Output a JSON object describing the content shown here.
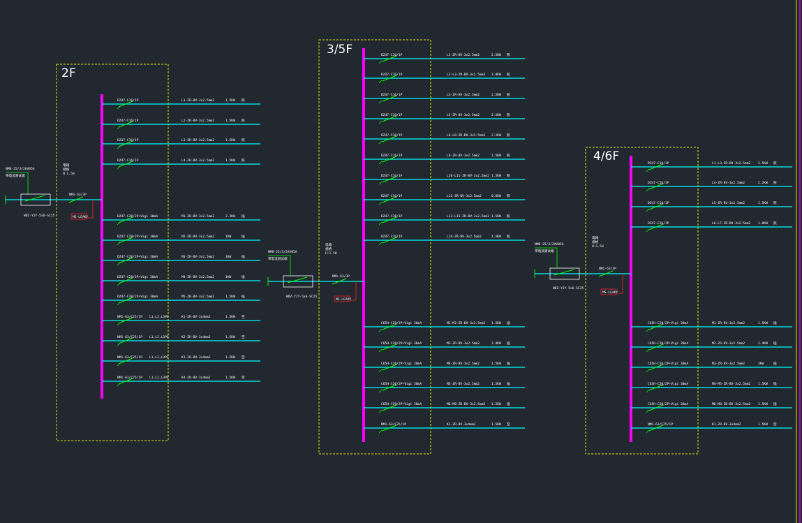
{
  "colors": {
    "background": "#212830",
    "busbar": "#ff00ff",
    "feeder_line": "#00ffff",
    "breaker": "#00ff00",
    "panel_border": "#e6e600",
    "text": "#ffffff",
    "tag": "#ff2020"
  },
  "panels": [
    {
      "title": "2F",
      "incoming": {
        "meter_label": "NM8-25/3/2AV05A",
        "meter_sub": "带电流测试端",
        "cable": "WDZ-YJY-5x6-SC25",
        "panel_info": [
          "电箱",
          "规格",
          "H:1.5H"
        ],
        "main_breaker": "NM1-63/3P",
        "tag": "MS-LEAKY"
      },
      "circuits": [
        {
          "breaker": "DZ47-C16/1P",
          "cable": "L1-ZR-BV-3x2.5mm2",
          "power": "1.5KW",
          "use": "照"
        },
        {
          "breaker": "DZ47-C16/1P",
          "cable": "L2-ZR-BV-3x2.5mm2",
          "power": "1.5KW",
          "use": "照"
        },
        {
          "breaker": "DZ47-C16/1P",
          "cable": "L3-ZR-BV-3x2.5mm2",
          "power": "1.5KW",
          "use": "照"
        },
        {
          "breaker": "DZ47-C16/1P",
          "cable": "L4-ZR-BV-3x2.5mm2",
          "power": "1.5KW",
          "use": "照"
        },
        {
          "breaker": "DZ47-C20/2P+Vigi 30mA",
          "cable": "M1-ZR-BV-3x2.5mm2",
          "power": "2.2KW",
          "use": "插"
        },
        {
          "breaker": "DZ47-C20/2P+Vigi 30mA",
          "cable": "M2-ZR-BV-3x2.5mm2",
          "power": "1KW",
          "use": "插"
        },
        {
          "breaker": "DZ47-C20/2P+Vigi 30mA",
          "cable": "M3-ZR-BV-3x2.5mm2",
          "power": "1KW",
          "use": "插"
        },
        {
          "breaker": "DZ47-C20/2P+Vigi 30mA",
          "cable": "M4-ZR-BV-3x2.5mm2",
          "power": "1KW",
          "use": "插"
        },
        {
          "breaker": "DZ47-C20/2P+Vigi 30mA",
          "cable": "M5-ZR-BV-3x2.5mm2",
          "power": "1.5KW",
          "use": "插"
        },
        {
          "breaker": "NM1-63/C25/1P",
          "extra": "L1,L2,L3PE",
          "cable": "K1-ZR-BV-3x4mm2",
          "power": "1.5KW",
          "use": "空"
        },
        {
          "breaker": "NM1-63/C25/1P",
          "extra": "L1,L2,L3PE",
          "cable": "K2-ZR-BV-3x4mm2",
          "power": "1.5KW",
          "use": "空"
        },
        {
          "breaker": "NM1-63/C25/1P",
          "extra": "L1,L2,L3PE",
          "cable": "K3-ZR-BV-3x4mm2",
          "power": "1.5KW",
          "use": "空"
        },
        {
          "breaker": "NM1-63/C25/1P",
          "extra": "L1,L2,L3PE",
          "cable": "K4-ZR-BV-3x4mm2",
          "power": "1.5KW",
          "use": "空"
        }
      ]
    },
    {
      "title": "3/5F",
      "incoming": {
        "meter_label": "NM8-25/3/2AV05A",
        "meter_sub": "带电流测试端",
        "cable": "WDZ-YJY-5x6-SC25",
        "panel_info": [
          "电箱",
          "规格",
          "H:1.5H"
        ],
        "main_breaker": "NM1-63/3P",
        "tag": "MS-LEAKY"
      },
      "circuits": [
        {
          "breaker": "DZ47-C16/1P",
          "cable": "L1-ZR-BV-3x2.5mm2",
          "power": "2.5KW",
          "use": "照"
        },
        {
          "breaker": "DZ47-C16/1P",
          "cable": "L2-L3-ZR-BV-3x2.5mm2",
          "power": "3.0KW",
          "use": "照"
        },
        {
          "breaker": "DZ47-C16/1P",
          "cable": "L4-ZR-BV-3x2.5mm2",
          "power": "2.5KW",
          "use": "照"
        },
        {
          "breaker": "DZ47-C16/1P",
          "cable": "L5-ZR-BV-3x2.5mm2",
          "power": "2.1KW",
          "use": "照"
        },
        {
          "breaker": "DZ47-C16/1P",
          "cable": "L6-L8-ZR-BV-3x2.5mm2",
          "power": "2.1KW",
          "use": "照"
        },
        {
          "breaker": "DZ47-C16/1P",
          "cable": "L9-ZR-BV-3x2.5mm2",
          "power": "1.5KW",
          "use": "照"
        },
        {
          "breaker": "DZ47-C16/1P",
          "cable": "L10-L11-ZR-BV-3x2.5mm2",
          "power": "1.5KW",
          "use": "照"
        },
        {
          "breaker": "DZ47-C16/1P",
          "cable": "L12-ZR-BV-3x2.5mm2",
          "power": "0.6KW",
          "use": "照"
        },
        {
          "breaker": "DZ47-C16/1P",
          "cable": "L13-L15-ZR-BV-3x2.5mm2",
          "power": "1.5KW",
          "use": "照"
        },
        {
          "breaker": "DZ47-C16/1P",
          "cable": "L16-ZR-BV-3x2.5mm2",
          "power": "1.5KW",
          "use": "照"
        },
        {
          "breaker": "C65H-C20/2P+Vigi 30mA",
          "cable": "M1-M2-ZR-BV-3x2.5mm2",
          "power": "1.5KW",
          "use": "插"
        },
        {
          "breaker": "C65H-C20/2P+Vigi 30mA",
          "cable": "M3-ZR-BV-3x2.5mm2",
          "power": "2.4KW",
          "use": "插"
        },
        {
          "breaker": "C65H-C20/2P+Vigi 30mA",
          "cable": "M4-ZR-BV-3x2.5mm2",
          "power": "1.5KW",
          "use": "插"
        },
        {
          "breaker": "C65H-C20/2P+Vigi 30mA",
          "cable": "M5-ZR-BV-3x2.5mm2",
          "power": "1.5KW",
          "use": "插"
        },
        {
          "breaker": "C65H-C20/2P+Vigi 30mA",
          "cable": "M6-M8-ZR-BV-3x2.5mm2",
          "power": "1.5KW",
          "use": "插"
        },
        {
          "breaker": "NM1-63/C25/1P",
          "cable": "K1-ZR-BV-3x4mm2",
          "power": "1.5KW",
          "use": "空"
        }
      ]
    },
    {
      "title": "4/6F",
      "incoming": {
        "meter_label": "NM8-25/3/2AV05A",
        "meter_sub": "带电流测试端",
        "cable": "WDZ-YJY-5x6-SC25",
        "panel_info": [
          "电箱",
          "规格",
          "H:1.5H"
        ],
        "main_breaker": "NM1-63/3P",
        "tag": "MS-LEAKY"
      },
      "circuits": [
        {
          "breaker": "DZ47-C16/1P",
          "cable": "L1-L3-ZR-BV-3x2.5mm2",
          "power": "2.5KW",
          "use": "照"
        },
        {
          "breaker": "DZ47-C16/1P",
          "cable": "L4-ZR-BV-3x2.5mm2",
          "power": "2.2KW",
          "use": "照"
        },
        {
          "breaker": "DZ47-C16/1P",
          "cable": "L5-ZR-BV-3x2.5mm2",
          "power": "1.5KW",
          "use": "照"
        },
        {
          "breaker": "DZ47-C16/1P",
          "cable": "L6-L7-ZR-BV-3x2.5mm2",
          "power": "1.8KW",
          "use": "照"
        },
        {
          "breaker": "C65H-C20/2P+Vigi 30mA",
          "cable": "M1-ZR-BV-3x2.5mm2",
          "power": "1.5KW",
          "use": "插"
        },
        {
          "breaker": "C65H-C20/2P+Vigi 30mA",
          "cable": "M2-ZR-BV-3x2.5mm2",
          "power": "2.4KW",
          "use": "插"
        },
        {
          "breaker": "C65H-C20/2P+Vigi 30mA",
          "cable": "M3-ZR-BV-3x2.5mm2",
          "power": "3KW",
          "use": "插"
        },
        {
          "breaker": "C65H-C20/2P+Vigi 30mA",
          "cable": "M4-M5-ZR-BV-3x2.5mm2",
          "power": "1.5KW",
          "use": "插"
        },
        {
          "breaker": "C65H-C20/2P+Vigi 30mA",
          "cable": "M6-M8-ZR-BV-3x2.5mm2",
          "power": "1.5KW",
          "use": "插"
        },
        {
          "breaker": "NM1-63/C25/1P",
          "cable": "K1-ZR-BV-3x4mm2",
          "power": "1.5KW",
          "use": "空"
        }
      ]
    }
  ]
}
